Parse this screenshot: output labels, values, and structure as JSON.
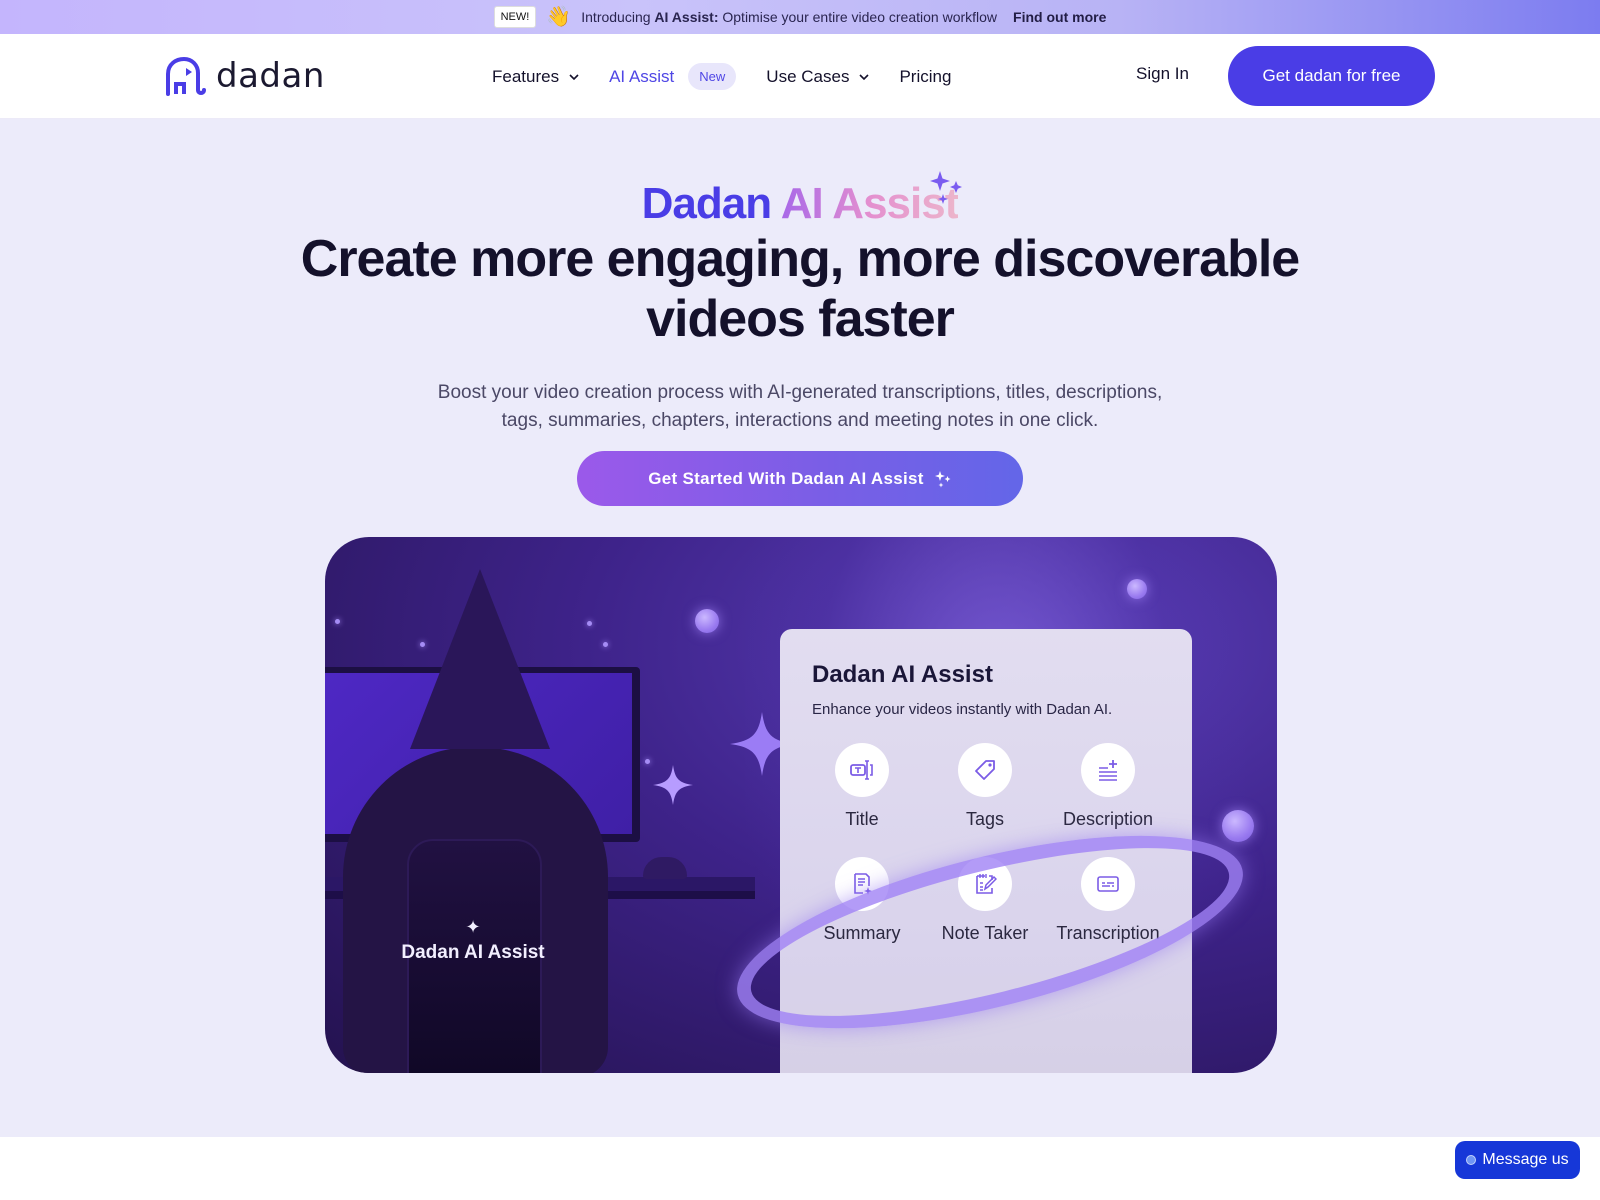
{
  "announcement": {
    "badge": "NEW!",
    "emoji": "👋",
    "intro": "Introducing",
    "highlight": "AI Assist:",
    "message": "Optimise your entire video creation workflow",
    "link": "Find out more"
  },
  "header": {
    "logo_text": "dadan",
    "nav": [
      {
        "label": "Features",
        "has_dropdown": true
      },
      {
        "label": "AI Assist",
        "badge": "New"
      },
      {
        "label": "Use Cases",
        "has_dropdown": true
      },
      {
        "label": "Pricing"
      }
    ],
    "sign_in": "Sign In",
    "cta": "Get dadan for free"
  },
  "hero": {
    "kicker_part1": "Dadan",
    "kicker_part2": "AI Assist",
    "title_line1": "Create more engaging, more discoverable",
    "title_line2": "videos faster",
    "subtitle_line1": "Boost your video creation process with AI-generated transcriptions, titles, descriptions,",
    "subtitle_line2": "tags, summaries, chapters, interactions and meeting notes in one click.",
    "cta": "Get Started With Dadan AI Assist"
  },
  "illustration": {
    "label": "Dadan AI Assist",
    "card": {
      "title": "Dadan AI Assist",
      "subtitle": "Enhance your videos instantly with Dadan AI.",
      "features": [
        {
          "label": "Title",
          "icon": "title-icon"
        },
        {
          "label": "Tags",
          "icon": "tag-icon"
        },
        {
          "label": "Description",
          "icon": "description-icon"
        },
        {
          "label": "Summary",
          "icon": "summary-icon"
        },
        {
          "label": "Note Taker",
          "icon": "note-taker-icon"
        },
        {
          "label": "Transcription",
          "icon": "transcription-icon"
        }
      ]
    }
  },
  "chat_widget": {
    "label": "Message us"
  },
  "colors": {
    "brand": "#4a3de6",
    "hero_bg": "#ecebfa",
    "chat_button": "#1637d8"
  }
}
